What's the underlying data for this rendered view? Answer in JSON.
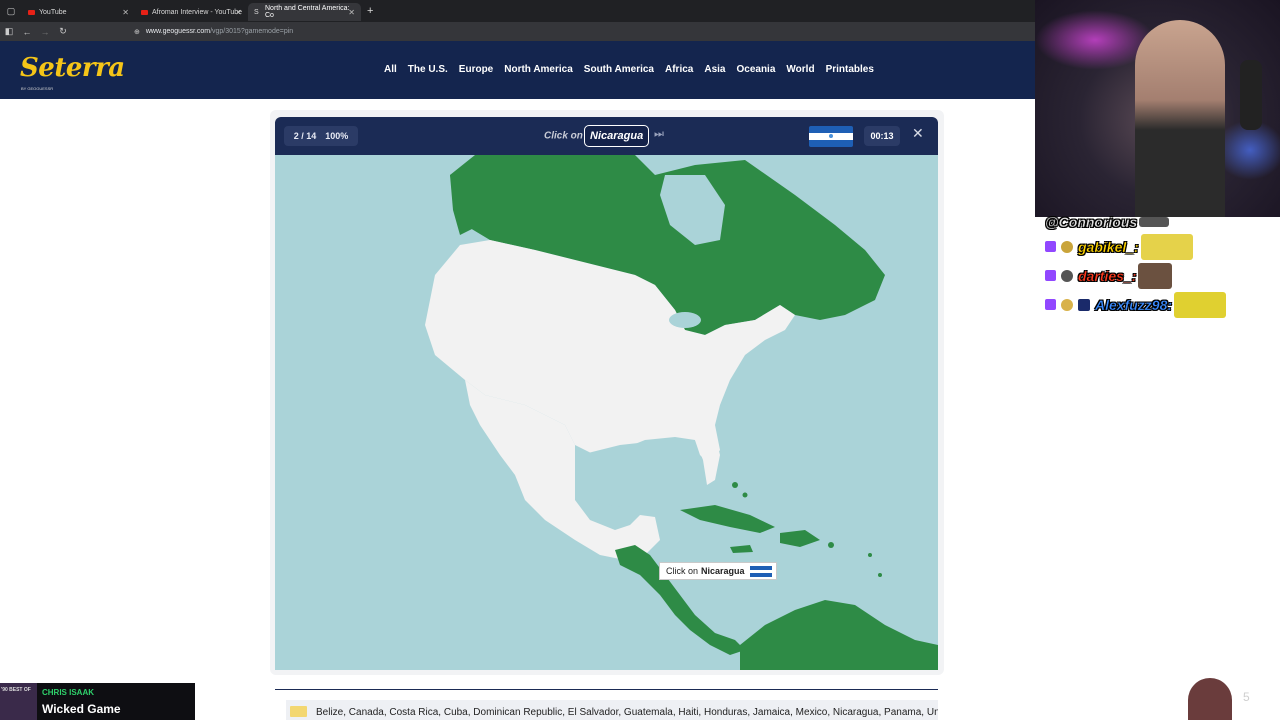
{
  "browser": {
    "tabs": [
      {
        "label": "YouTube",
        "active": false
      },
      {
        "label": "Afroman Interview - YouTube",
        "active": false
      },
      {
        "label": "North and Central America: Co",
        "active": true
      }
    ],
    "url": {
      "host": "www.geoguessr.com",
      "path": "/vgp/3015?gamemode=pin"
    }
  },
  "site": {
    "logo": "Seterra",
    "logo_sub": "BY GEOGUESSR",
    "nav": [
      "All",
      "The U.S.",
      "Europe",
      "North America",
      "South America",
      "Africa",
      "Asia",
      "Oceania",
      "World",
      "Printables"
    ]
  },
  "game": {
    "progress": "2 / 14",
    "score": "100%",
    "prompt": "Click on",
    "target": "Nicaragua",
    "timer": "00:13",
    "tooltip_prefix": "Click on",
    "tooltip_target": "Nicaragua",
    "colors": {
      "correct": "#2e8b46",
      "land": "#f2f2f2",
      "water": "#aad3d8",
      "header": "#1b2b55"
    }
  },
  "answers_list": "Belize, Canada, Costa Rica, Cuba, Dominican Republic, El Salvador, Guatemala, Haiti, Honduras, Jamaica, Mexico, Nicaragua, Panama, United",
  "stream": {
    "chat": [
      {
        "user": "@Connorious",
        "color": "#e0e0e0"
      },
      {
        "user": "gabikel_:",
        "color": "#ffd400"
      },
      {
        "user": "darties_:",
        "color": "#ff3b1f"
      },
      {
        "user": "Alexfuzz98:",
        "color": "#3a8bff"
      }
    ],
    "music": {
      "art_label": "'90 BEST OF",
      "artist": "CHRIS ISAAK",
      "song": "Wicked Game"
    },
    "corner_number": "5"
  }
}
